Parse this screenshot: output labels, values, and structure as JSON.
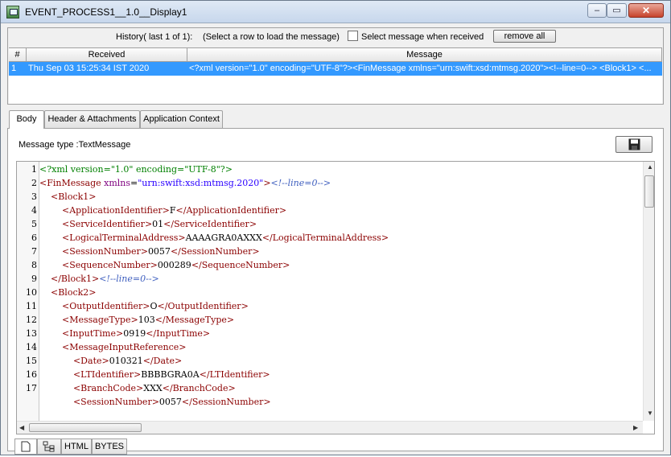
{
  "window": {
    "title": "EVENT_PROCESS1__1.0__Display1",
    "min_icon": "minimize-icon",
    "max_icon": "maximize-icon",
    "close_icon": "close-icon"
  },
  "history": {
    "label": "History( last 1 of 1):",
    "hint": "(Select a row to load the message)",
    "checkbox_label": "Select message when received",
    "checkbox_checked": false,
    "remove_all_label": "remove all",
    "columns": [
      "#",
      "Received",
      "Message"
    ],
    "rows": [
      {
        "num": "1",
        "received": "Thu Sep 03 15:25:34 IST 2020",
        "message": "<?xml version=\"1.0\" encoding=\"UTF-8\"?><FinMessage xmlns=\"urn:swift:xsd:mtmsg.2020\"><!--line=0-->   <Block1>   <..."
      }
    ],
    "selected_row_color": "#3399ff"
  },
  "tabs": {
    "items": [
      "Body",
      "Header & Attachments",
      "Application Context"
    ],
    "active": "Body"
  },
  "body": {
    "message_type_label": "Message type :TextMessage",
    "save_icon": "save-icon"
  },
  "editor": {
    "line_numbers": [
      "1",
      "2",
      "3",
      "4",
      "5",
      "6",
      "7",
      "8",
      "9",
      "10",
      "11",
      "12",
      "13",
      "14",
      "15",
      "16",
      "17"
    ],
    "lines": [
      "<?xml version=\"1.0\" encoding=\"UTF-8\"?>",
      "<FinMessage xmlns=\"urn:swift:xsd:mtmsg.2020\"><!--line=0-->",
      "    <Block1>",
      "        <ApplicationIdentifier>F</ApplicationIdentifier>",
      "        <ServiceIdentifier>01</ServiceIdentifier>",
      "        <LogicalTerminalAddress>AAAAGRA0AXXX</LogicalTerminalAddress>",
      "        <SessionNumber>0057</SessionNumber>",
      "        <SequenceNumber>000289</SequenceNumber>",
      "    </Block1><!--line=0-->",
      "    <Block2>",
      "        <OutputIdentifier>O</OutputIdentifier>",
      "        <MessageType>103</MessageType>",
      "        <InputTime>0919</InputTime>",
      "        <MessageInputReference>",
      "            <Date>010321</Date>",
      "            <LTIdentifier>BBBBGRA0A</LTIdentifier>",
      "            <BranchCode>XXX</BranchCode>",
      "            <SessionNumber>0057</SessionNumber>"
    ]
  },
  "bottom_tabs": {
    "items": [
      "HTML",
      "BYTES"
    ],
    "icons": [
      "document-icon",
      "tree-icon"
    ]
  }
}
